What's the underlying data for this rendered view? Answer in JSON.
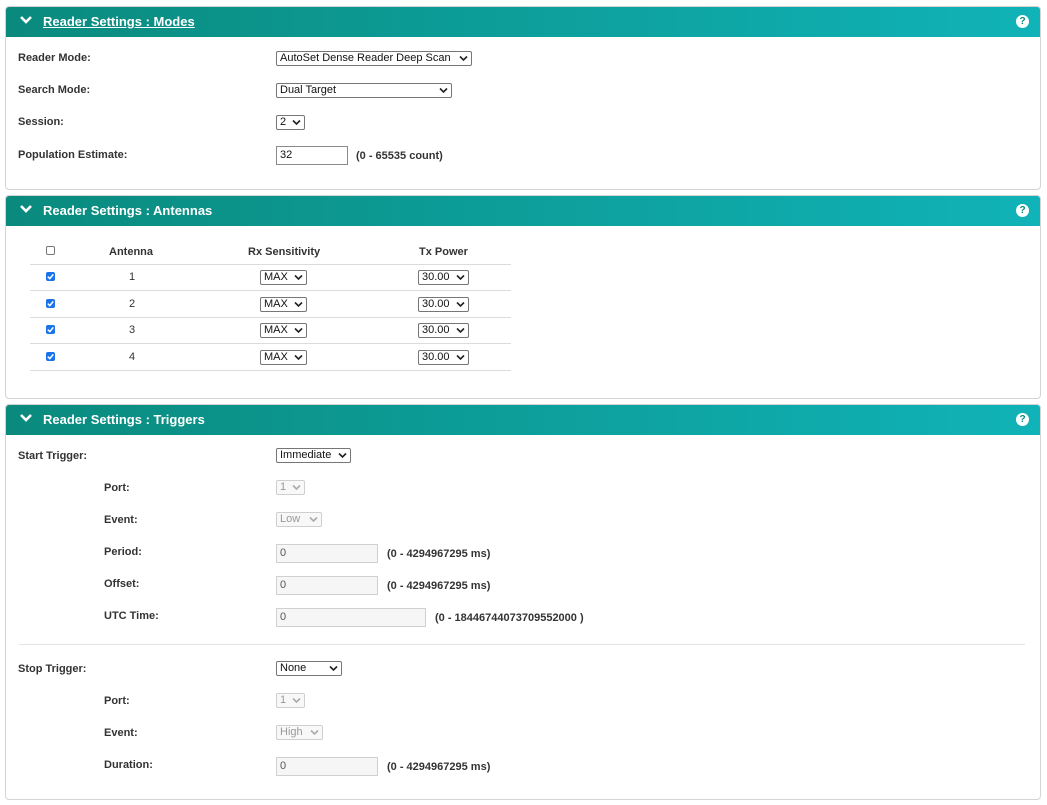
{
  "modes": {
    "title": "Reader Settings : Modes",
    "help": "?",
    "reader_mode": {
      "label": "Reader Mode:",
      "value": "AutoSet Dense Reader Deep Scan"
    },
    "search_mode": {
      "label": "Search Mode:",
      "value": "Dual Target"
    },
    "session": {
      "label": "Session:",
      "value": "2"
    },
    "population": {
      "label": "Population Estimate:",
      "value": "32",
      "range": "(0 - 65535 count)"
    }
  },
  "antennas": {
    "title": "Reader Settings : Antennas",
    "help": "?",
    "headers": {
      "antenna": "Antenna",
      "rx": "Rx Sensitivity",
      "tx": "Tx Power"
    },
    "rows": [
      {
        "antenna": "1",
        "checked": true,
        "rx": "MAX",
        "tx": "30.00"
      },
      {
        "antenna": "2",
        "checked": true,
        "rx": "MAX",
        "tx": "30.00"
      },
      {
        "antenna": "3",
        "checked": true,
        "rx": "MAX",
        "tx": "30.00"
      },
      {
        "antenna": "4",
        "checked": true,
        "rx": "MAX",
        "tx": "30.00"
      }
    ]
  },
  "triggers": {
    "title": "Reader Settings : Triggers",
    "help": "?",
    "start": {
      "label": "Start Trigger:",
      "value": "Immediate",
      "port": {
        "label": "Port:",
        "value": "1"
      },
      "event": {
        "label": "Event:",
        "value": "Low"
      },
      "period": {
        "label": "Period:",
        "value": "0",
        "range": "(0 - 4294967295 ms)"
      },
      "offset": {
        "label": "Offset:",
        "value": "0",
        "range": "(0 - 4294967295 ms)"
      },
      "utc": {
        "label": "UTC Time:",
        "value": "0",
        "range": "(0 - 18446744073709552000 )"
      }
    },
    "stop": {
      "label": "Stop Trigger:",
      "value": "None",
      "port": {
        "label": "Port:",
        "value": "1"
      },
      "event": {
        "label": "Event:",
        "value": "High"
      },
      "duration": {
        "label": "Duration:",
        "value": "0",
        "range": "(0 - 4294967295 ms)"
      }
    }
  }
}
